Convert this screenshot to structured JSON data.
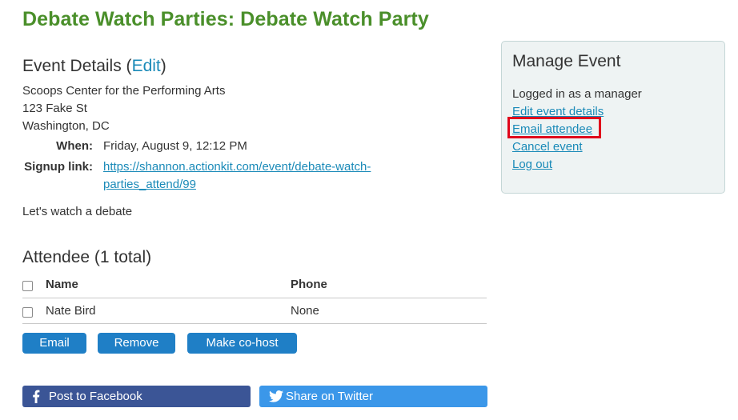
{
  "page": {
    "title": "Debate Watch Parties: Debate Watch Party"
  },
  "event_details": {
    "heading": "Event Details (",
    "edit_label": "Edit",
    "heading_close": ")",
    "address_lines": [
      "Scoops Center for the Performing Arts",
      "123 Fake St",
      "Washington, DC"
    ],
    "when_label": "When:",
    "when_value": "Friday, August 9, 12:12 PM",
    "signup_label": "Signup link:",
    "signup_line1": "https://shannon.actionkit.com/event/debate-watch-",
    "signup_line2": "parties_attend/99",
    "description": "Let's watch a debate"
  },
  "attendees": {
    "heading": "Attendee (1 total)",
    "columns": [
      "Name",
      "Phone"
    ],
    "rows": [
      {
        "name": "Nate Bird",
        "phone": "None"
      }
    ]
  },
  "actions": {
    "email": "Email",
    "remove": "Remove",
    "make_cohost": "Make co-host"
  },
  "share": {
    "facebook": "Post to Facebook",
    "twitter": "Share on Twitter",
    "facebook_color": "#3b5596",
    "twitter_color": "#3b97e9",
    "facebook_icon": "facebook-icon",
    "twitter_icon": "twitter-icon"
  },
  "manage": {
    "title": "Manage Event",
    "status": "Logged in as a manager",
    "links": [
      "Edit event details",
      "Email attendee",
      "Cancel event",
      "Log out"
    ],
    "highlighted_link": "Email attendee"
  },
  "colors": {
    "title_green": "#4a8f2a",
    "link_blue": "#1a8ab8",
    "button_blue": "#1f7fc6",
    "highlight_red": "#e0061b"
  }
}
